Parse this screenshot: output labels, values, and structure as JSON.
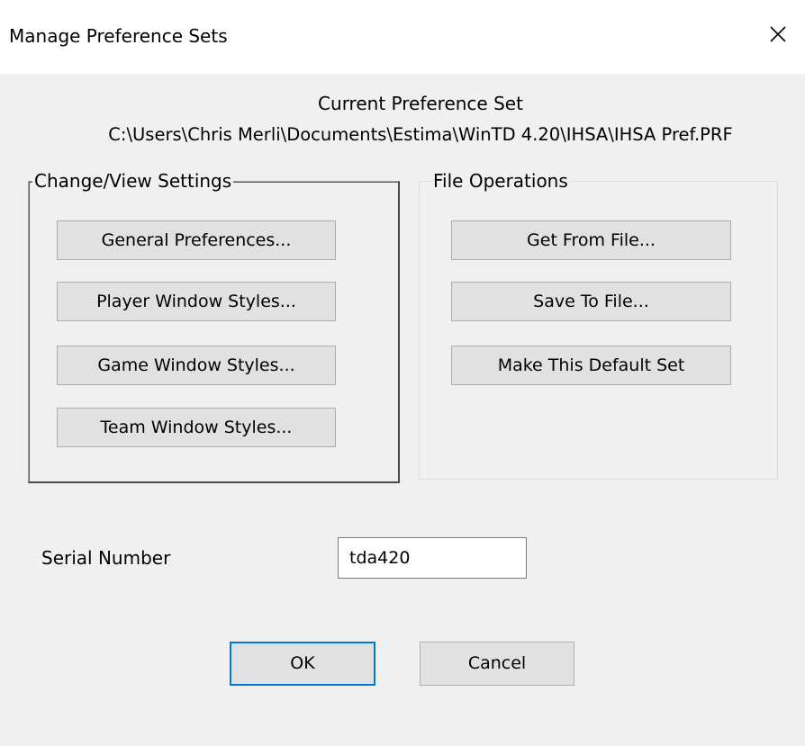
{
  "window": {
    "title": "Manage Preference Sets",
    "close_icon": "close-icon"
  },
  "current_set": {
    "label": "Current Preference Set",
    "path": "C:\\Users\\Chris Merli\\Documents\\Estima\\WinTD 4.20\\IHSA\\IHSA Pref.PRF"
  },
  "change_view": {
    "legend": "Change/View Settings",
    "buttons": [
      {
        "label": "General Preferences..."
      },
      {
        "label": "Player Window Styles..."
      },
      {
        "label": "Game Window Styles..."
      },
      {
        "label": "Team Window Styles..."
      }
    ]
  },
  "file_ops": {
    "legend": "File Operations",
    "buttons": [
      {
        "label": "Get From File..."
      },
      {
        "label": "Save To File..."
      },
      {
        "label": "Make This Default Set"
      }
    ]
  },
  "serial": {
    "label": "Serial Number",
    "value": "tda420"
  },
  "footer": {
    "ok_label": "OK",
    "cancel_label": "Cancel"
  },
  "colors": {
    "dialog_bg": "#f0f0f0",
    "button_bg": "#e1e1e1",
    "default_button_border": "#0078d7"
  }
}
